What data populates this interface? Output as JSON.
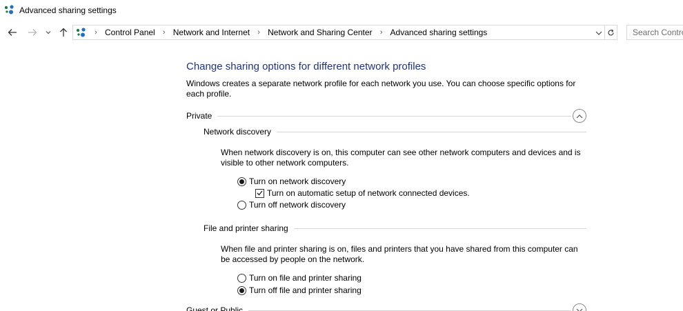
{
  "window": {
    "title": "Advanced sharing settings"
  },
  "nav": {
    "back": "back",
    "forward": "forward",
    "recent": "recent-locations",
    "up": "up"
  },
  "address": {
    "breadcrumbs": [
      "Control Panel",
      "Network and Internet",
      "Network and Sharing Center",
      "Advanced sharing settings"
    ]
  },
  "search": {
    "placeholder": "Search Control Panel"
  },
  "page": {
    "heading": "Change sharing options for different network profiles",
    "intro": "Windows creates a separate network profile for each network you use. You can choose specific options for each profile."
  },
  "private": {
    "label": "Private",
    "network_discovery": {
      "label": "Network discovery",
      "description": "When network discovery is on, this computer can see other network computers and devices and is visible to other network computers.",
      "option_on": "Turn on network discovery",
      "option_auto": "Turn on automatic setup of network connected devices.",
      "option_off": "Turn off network discovery",
      "selected": "on",
      "auto_setup_checked": true
    },
    "file_sharing": {
      "label": "File and printer sharing",
      "description": "When file and printer sharing is on, files and printers that you have shared from this computer can be accessed by people on the network.",
      "option_on": "Turn on file and printer sharing",
      "option_off": "Turn off file and printer sharing",
      "selected": "off"
    }
  },
  "next_section": {
    "label": "Guest or Public"
  },
  "colors": {
    "heading": "#1e3287",
    "border": "#d9d9d9",
    "divider": "#d5d5d5"
  }
}
